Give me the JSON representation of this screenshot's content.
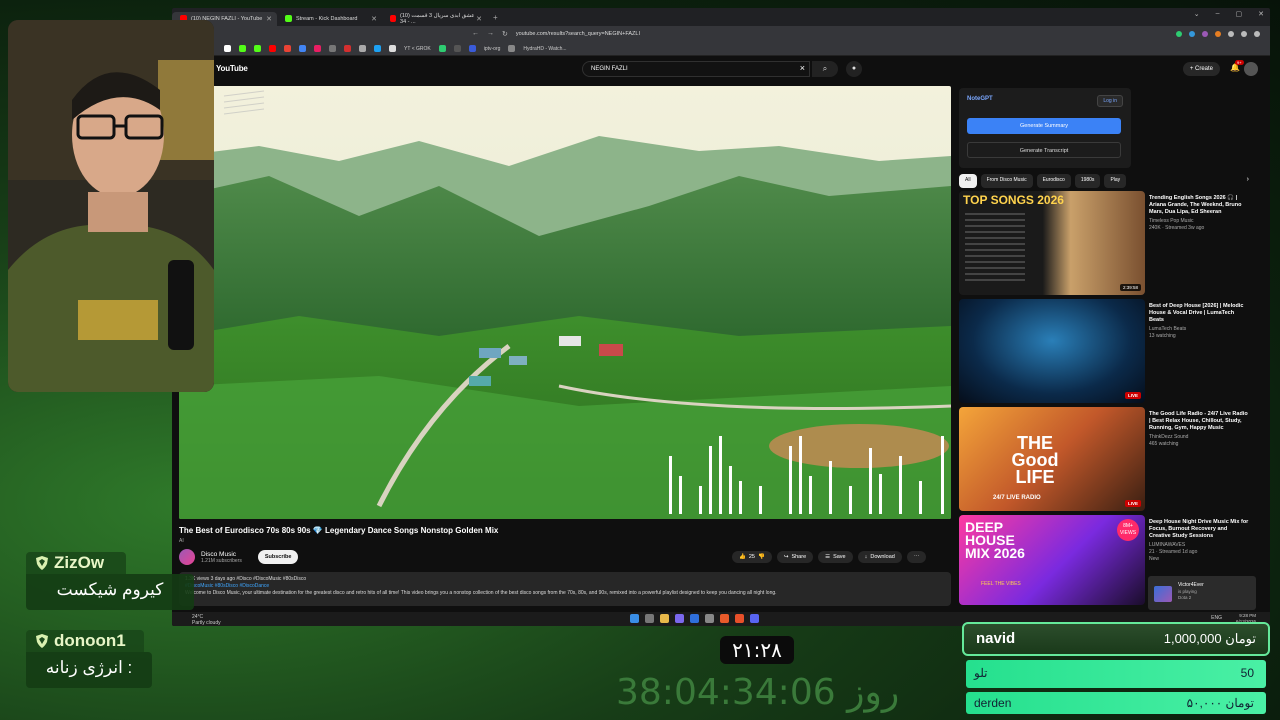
{
  "browser": {
    "tabs": [
      {
        "label": "(10) NEGIN FAZLI - YouTube",
        "color": "#ff0000",
        "active": true
      },
      {
        "label": "Stream - Kick Dashboard",
        "color": "#53fc18",
        "active": false
      },
      {
        "label": "(10) عشق ابدی سریال 3 قسمت 34 - ...",
        "color": "#ff0000",
        "active": false
      }
    ],
    "url": "youtube.com/results?search_query=NEGIN+FAZLI",
    "bookmarks": [
      "YT < GROK",
      "iptv-org",
      "HydraHD - Watch..."
    ]
  },
  "youtube": {
    "logo": "YouTube",
    "search_value": "NEGIN FAZLI",
    "create_label": "Create",
    "notif_count": "9+",
    "video": {
      "title": "The Best of Eurodisco 70s 80s 90s 💎 Legendary Dance Songs Nonstop Golden Mix",
      "ai_label": "AI",
      "channel": "Disco Music",
      "subs": "1.21M subscribers",
      "subscribe": "Subscribe",
      "likes": "25",
      "share": "Share",
      "save": "Save",
      "download": "Download",
      "desc_meta": "1.3K views  3 days ago  #Disco #DiscoMusic #80sDisco",
      "desc_tags": "#DiscoMusic #80sDisco #DiscoDance",
      "desc_text": "Welcome to Disco Music, your ultimate destination for the greatest disco and retro hits of all time! This video brings you a nonstop collection of the best disco songs from the 70s, 80s, and 90s, remixed into a powerful playlist designed to keep you dancing all night long."
    },
    "notegpt": {
      "name": "NoteGPT",
      "login": "Log in",
      "summary": "Generate Summary",
      "transcript": "Generate Transcript"
    },
    "chips": [
      "All",
      "From Disco Music",
      "Eurodisco",
      "1980s",
      "Play"
    ],
    "recs": [
      {
        "title": "Trending English Songs 2026 🎧 | Ariana Grande, The Weeknd, Bruno Mars, Dua Lipa, Ed Sheeran",
        "channel": "Timeless Pop Music",
        "meta": "240K · Streamed 3w ago",
        "badge": "2:39:58",
        "thumb_text": "TOP SONGS 2026"
      },
      {
        "title": "Best of Deep House [2026] | Melodic House & Vocal Drive | LumaTech Beats",
        "channel": "LumaTech Beats",
        "meta": "13 watching",
        "badge": "LIVE",
        "thumb_text": ""
      },
      {
        "title": "The Good Life Radio - 24/7 Live Radio | Best Relax House, Chillout, Study, Running, Gym, Happy Music",
        "channel": "ThinkDezz Sound",
        "meta": "465 watching",
        "badge": "LIVE",
        "thumb_text": "THE Good LIFE",
        "thumb_sub": "24/7 LIVE RADIO"
      },
      {
        "title": "Deep House Night Drive Music Mix for Focus, Burnout Recovery and Creative Study Sessions",
        "channel": "LUMINAWAVES",
        "meta": "21 · Streamed 1d ago",
        "badge": "New",
        "thumb_text": "DEEP HOUSE MIX 2026",
        "thumb_sub": "FEEL THE VIBES",
        "thumb_badge": "8M+ VIEWS"
      }
    ]
  },
  "taskbar": {
    "weather": "Partly cloudy",
    "weather_temp": "24°C",
    "lang": "ENG",
    "time": "9:28 PM",
    "date": "6/13/2026",
    "popup_name": "Victor4Ever",
    "popup_status": "is playing",
    "popup_game": "Dota 2"
  },
  "overlay": {
    "chat": [
      {
        "user": "ZizOw",
        "message": "کیروم شیکست"
      },
      {
        "user": "donoon1",
        "message": "انرژی زنانه :"
      }
    ],
    "clock": "۲۱:۲۸",
    "countdown": "38:04:34:06 روز",
    "donor_top": {
      "name": "navid",
      "amount": "تومان 1,000,000"
    },
    "donor_bars": [
      {
        "name": "تلو",
        "amount": "50"
      },
      {
        "name": "derden",
        "amount": "تومان ۵۰,۰۰۰"
      }
    ]
  },
  "colors": {
    "accent": "#65e89a",
    "youtube_red": "#ff0000",
    "kick_green": "#53fc18"
  }
}
